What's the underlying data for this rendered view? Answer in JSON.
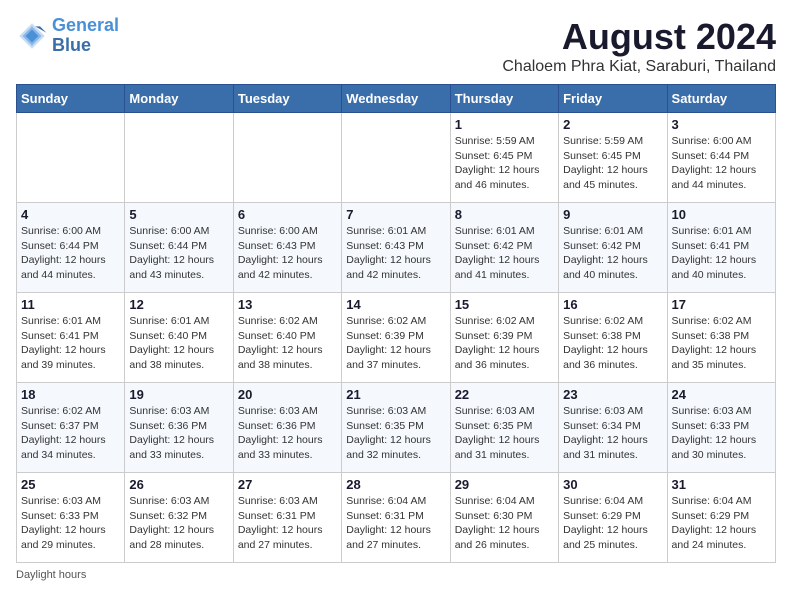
{
  "header": {
    "logo_line1": "General",
    "logo_line2": "Blue",
    "title": "August 2024",
    "subtitle": "Chaloem Phra Kiat, Saraburi, Thailand"
  },
  "weekdays": [
    "Sunday",
    "Monday",
    "Tuesday",
    "Wednesday",
    "Thursday",
    "Friday",
    "Saturday"
  ],
  "weeks": [
    [
      {
        "day": "",
        "info": ""
      },
      {
        "day": "",
        "info": ""
      },
      {
        "day": "",
        "info": ""
      },
      {
        "day": "",
        "info": ""
      },
      {
        "day": "1",
        "info": "Sunrise: 5:59 AM\nSunset: 6:45 PM\nDaylight: 12 hours\nand 46 minutes."
      },
      {
        "day": "2",
        "info": "Sunrise: 5:59 AM\nSunset: 6:45 PM\nDaylight: 12 hours\nand 45 minutes."
      },
      {
        "day": "3",
        "info": "Sunrise: 6:00 AM\nSunset: 6:44 PM\nDaylight: 12 hours\nand 44 minutes."
      }
    ],
    [
      {
        "day": "4",
        "info": "Sunrise: 6:00 AM\nSunset: 6:44 PM\nDaylight: 12 hours\nand 44 minutes."
      },
      {
        "day": "5",
        "info": "Sunrise: 6:00 AM\nSunset: 6:44 PM\nDaylight: 12 hours\nand 43 minutes."
      },
      {
        "day": "6",
        "info": "Sunrise: 6:00 AM\nSunset: 6:43 PM\nDaylight: 12 hours\nand 42 minutes."
      },
      {
        "day": "7",
        "info": "Sunrise: 6:01 AM\nSunset: 6:43 PM\nDaylight: 12 hours\nand 42 minutes."
      },
      {
        "day": "8",
        "info": "Sunrise: 6:01 AM\nSunset: 6:42 PM\nDaylight: 12 hours\nand 41 minutes."
      },
      {
        "day": "9",
        "info": "Sunrise: 6:01 AM\nSunset: 6:42 PM\nDaylight: 12 hours\nand 40 minutes."
      },
      {
        "day": "10",
        "info": "Sunrise: 6:01 AM\nSunset: 6:41 PM\nDaylight: 12 hours\nand 40 minutes."
      }
    ],
    [
      {
        "day": "11",
        "info": "Sunrise: 6:01 AM\nSunset: 6:41 PM\nDaylight: 12 hours\nand 39 minutes."
      },
      {
        "day": "12",
        "info": "Sunrise: 6:01 AM\nSunset: 6:40 PM\nDaylight: 12 hours\nand 38 minutes."
      },
      {
        "day": "13",
        "info": "Sunrise: 6:02 AM\nSunset: 6:40 PM\nDaylight: 12 hours\nand 38 minutes."
      },
      {
        "day": "14",
        "info": "Sunrise: 6:02 AM\nSunset: 6:39 PM\nDaylight: 12 hours\nand 37 minutes."
      },
      {
        "day": "15",
        "info": "Sunrise: 6:02 AM\nSunset: 6:39 PM\nDaylight: 12 hours\nand 36 minutes."
      },
      {
        "day": "16",
        "info": "Sunrise: 6:02 AM\nSunset: 6:38 PM\nDaylight: 12 hours\nand 36 minutes."
      },
      {
        "day": "17",
        "info": "Sunrise: 6:02 AM\nSunset: 6:38 PM\nDaylight: 12 hours\nand 35 minutes."
      }
    ],
    [
      {
        "day": "18",
        "info": "Sunrise: 6:02 AM\nSunset: 6:37 PM\nDaylight: 12 hours\nand 34 minutes."
      },
      {
        "day": "19",
        "info": "Sunrise: 6:03 AM\nSunset: 6:36 PM\nDaylight: 12 hours\nand 33 minutes."
      },
      {
        "day": "20",
        "info": "Sunrise: 6:03 AM\nSunset: 6:36 PM\nDaylight: 12 hours\nand 33 minutes."
      },
      {
        "day": "21",
        "info": "Sunrise: 6:03 AM\nSunset: 6:35 PM\nDaylight: 12 hours\nand 32 minutes."
      },
      {
        "day": "22",
        "info": "Sunrise: 6:03 AM\nSunset: 6:35 PM\nDaylight: 12 hours\nand 31 minutes."
      },
      {
        "day": "23",
        "info": "Sunrise: 6:03 AM\nSunset: 6:34 PM\nDaylight: 12 hours\nand 31 minutes."
      },
      {
        "day": "24",
        "info": "Sunrise: 6:03 AM\nSunset: 6:33 PM\nDaylight: 12 hours\nand 30 minutes."
      }
    ],
    [
      {
        "day": "25",
        "info": "Sunrise: 6:03 AM\nSunset: 6:33 PM\nDaylight: 12 hours\nand 29 minutes."
      },
      {
        "day": "26",
        "info": "Sunrise: 6:03 AM\nSunset: 6:32 PM\nDaylight: 12 hours\nand 28 minutes."
      },
      {
        "day": "27",
        "info": "Sunrise: 6:03 AM\nSunset: 6:31 PM\nDaylight: 12 hours\nand 27 minutes."
      },
      {
        "day": "28",
        "info": "Sunrise: 6:04 AM\nSunset: 6:31 PM\nDaylight: 12 hours\nand 27 minutes."
      },
      {
        "day": "29",
        "info": "Sunrise: 6:04 AM\nSunset: 6:30 PM\nDaylight: 12 hours\nand 26 minutes."
      },
      {
        "day": "30",
        "info": "Sunrise: 6:04 AM\nSunset: 6:29 PM\nDaylight: 12 hours\nand 25 minutes."
      },
      {
        "day": "31",
        "info": "Sunrise: 6:04 AM\nSunset: 6:29 PM\nDaylight: 12 hours\nand 24 minutes."
      }
    ]
  ],
  "footer": {
    "daylight_label": "Daylight hours"
  }
}
